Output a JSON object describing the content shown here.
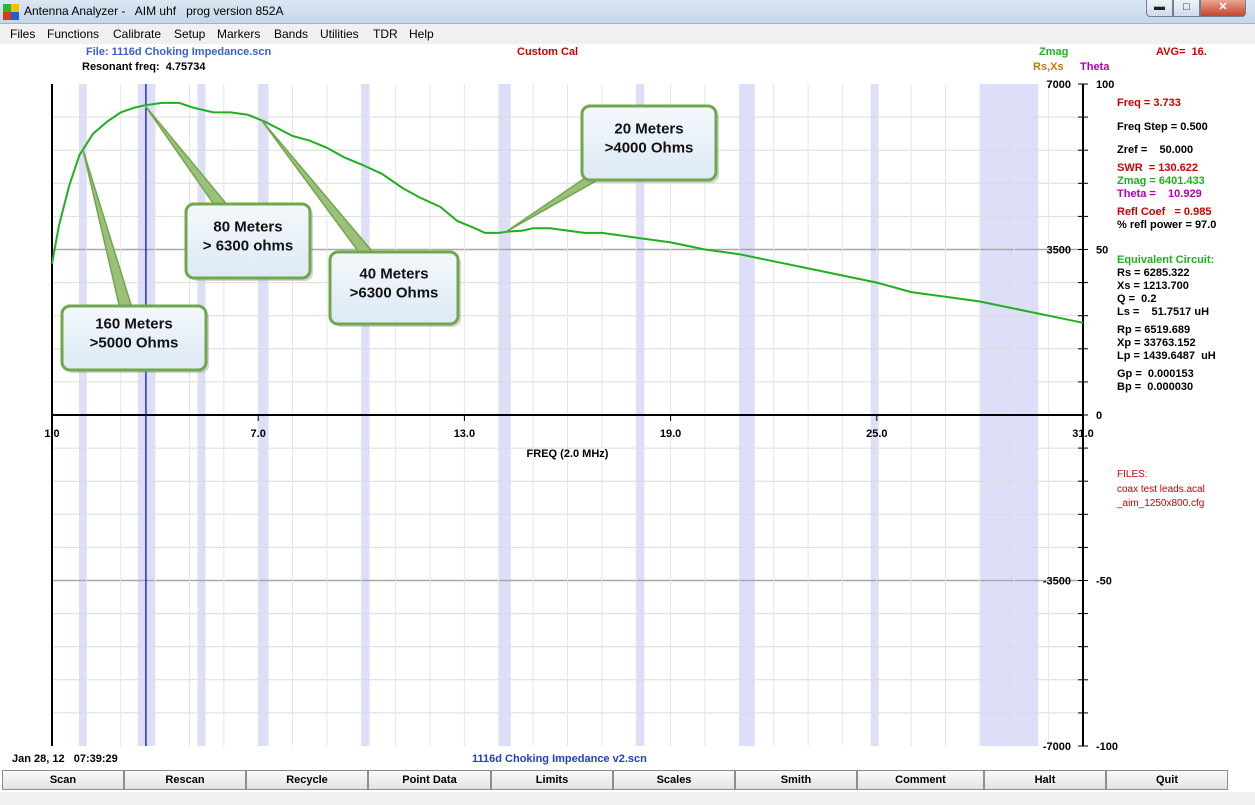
{
  "window": {
    "title": "Antenna Analyzer -   AIM uhf   prog version 852A",
    "min_glyph": "▬",
    "max_glyph": "□",
    "close_glyph": "✕"
  },
  "menu": [
    "Files",
    "Functions",
    "Calibrate",
    "Setup",
    "Markers",
    "Bands",
    "Utilities",
    "TDR",
    "Help"
  ],
  "header": {
    "file": "File: 1116d Choking Impedance.scn",
    "resonant": "Resonant freq:  4.75734",
    "cal": "Custom Cal",
    "zmag_legend": "Zmag",
    "rsxs_legend": "Rs,Xs",
    "theta_legend": "Theta",
    "avg": "AVG=  16."
  },
  "readout": {
    "freq": "Freq = 3.733",
    "freq_step": "Freq Step = 0.500",
    "zref": "Zref =    50.000",
    "swr": "SWR  = 130.622",
    "zmag": "Zmag = 6401.433",
    "theta": "Theta =    10.929",
    "refl_coef": "Refl Coef   = 0.985",
    "refl_power": "% refl power = 97.0",
    "eq_title": "Equivalent Circuit:",
    "rs": "Rs = 6285.322",
    "xs": "Xs = 1213.700",
    "q": "Q =  0.2",
    "ls": "Ls =    51.7517 uH",
    "rp": "Rp = 6519.689",
    "xp": "Xp = 33763.152",
    "lp": "Lp = 1439.6487  uH",
    "gp": "Gp =  0.000153",
    "bp": "Bp =  0.000030"
  },
  "files": {
    "title": "FILES:",
    "f1": "coax test leads.acal",
    "f2": "_aim_1250x800.cfg"
  },
  "footer": {
    "date": "Jan 28, 12   07:39:29",
    "scan_file": "1116d Choking Impedance v2.scn"
  },
  "buttons": [
    "Scan",
    "Rescan",
    "Recycle",
    "Point Data",
    "Limits",
    "Scales",
    "Smith",
    "Comment",
    "Halt",
    "Quit"
  ],
  "colors": {
    "zmag": "#1fb01f",
    "label_red": "#cc0000",
    "file_blue": "#3a5fd6",
    "theta": "#b000b0",
    "rsxs": "#c87800",
    "band": "#dcdff7",
    "cursor": "#0000c8",
    "callout_fill": "#dde9f5",
    "callout_border": "#6fa84a"
  },
  "chart_data": {
    "type": "line",
    "xlabel": "FREQ (2.0 MHz)",
    "x_ticks": [
      "1.0",
      "7.0",
      "13.0",
      "19.0",
      "25.0",
      "31.0"
    ],
    "xlim": [
      1.0,
      31.0
    ],
    "y_left_ticks": [
      "7000",
      "3500",
      "-3500",
      "-7000"
    ],
    "y_right_ticks": [
      "100",
      "50",
      "0",
      "-50",
      "-100"
    ],
    "ylim": [
      -7000,
      7000
    ],
    "cursor_freq": 3.733,
    "bands": [
      [
        1.8,
        2.0
      ],
      [
        3.5,
        4.0
      ],
      [
        5.3,
        5.4
      ],
      [
        7.0,
        7.3
      ],
      [
        10.1,
        10.15
      ],
      [
        14.0,
        14.35
      ],
      [
        18.07,
        18.17
      ],
      [
        21.0,
        21.45
      ],
      [
        24.89,
        24.99
      ],
      [
        28.0,
        29.7
      ]
    ],
    "series": [
      {
        "name": "Zmag",
        "x": [
          1.0,
          1.2,
          1.5,
          1.8,
          2.2,
          2.6,
          3.0,
          3.4,
          3.7,
          4.2,
          4.7,
          5.1,
          5.4,
          5.7,
          6.2,
          6.7,
          7.2,
          7.6,
          8.0,
          8.5,
          9.0,
          9.5,
          10.0,
          10.6,
          11.2,
          11.7,
          12.3,
          12.8,
          13.3,
          13.6,
          14.0,
          14.3,
          14.7,
          15.0,
          15.5,
          16.0,
          16.5,
          17.0,
          17.5,
          18.0,
          18.5,
          19.0,
          20.0,
          21.0,
          22.0,
          23.0,
          24.0,
          25.0,
          26.0,
          27.0,
          28.0,
          29.0,
          30.0,
          31.0
        ],
        "y": [
          3200,
          4000,
          4850,
          5500,
          5950,
          6200,
          6400,
          6500,
          6550,
          6600,
          6600,
          6500,
          6450,
          6400,
          6400,
          6350,
          6200,
          6050,
          5900,
          5800,
          5650,
          5450,
          5300,
          5100,
          4800,
          4600,
          4400,
          4100,
          3950,
          3850,
          3850,
          3880,
          3900,
          3950,
          3950,
          3900,
          3850,
          3850,
          3800,
          3750,
          3700,
          3650,
          3500,
          3400,
          3250,
          3100,
          2950,
          2800,
          2600,
          2500,
          2400,
          2250,
          2100,
          1950
        ]
      }
    ],
    "annotations": [
      {
        "text": "160 Meters\n>5000 Ohms",
        "freq": 1.9
      },
      {
        "text": "80 Meters\n> 6300 ohms",
        "freq": 3.7
      },
      {
        "text": "40 Meters\n>6300 Ohms",
        "freq": 7.1
      },
      {
        "text": "20 Meters\n>4000 Ohms",
        "freq": 14.2
      }
    ]
  }
}
